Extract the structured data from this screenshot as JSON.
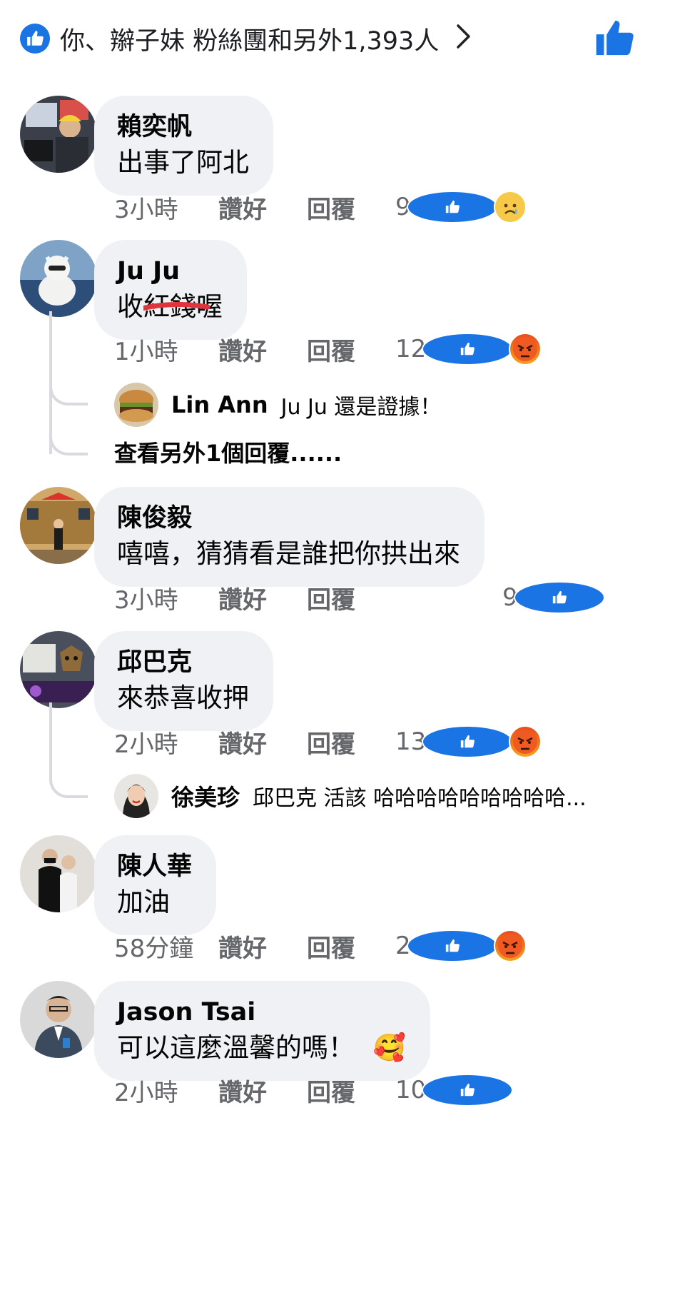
{
  "summary": {
    "text": "你、辮子妹 粉絲團和另外1,393人",
    "chevron": "›",
    "like_icon": "thumbs-up-icon"
  },
  "comments": [
    {
      "name": "賴奕帆",
      "text": "出事了阿北",
      "time": "3小時",
      "like": "讚好",
      "reply": "回覆",
      "count": "9",
      "reactions": [
        "like",
        "sad"
      ]
    },
    {
      "name": "Ju Ju",
      "text_prefix": "收",
      "text_struck": "紅錢",
      "text_suffix": "喔",
      "time": "1小時",
      "like": "讚好",
      "reply": "回覆",
      "count": "12",
      "reactions": [
        "like",
        "angry"
      ],
      "reply_preview": {
        "name": "Lin Ann",
        "text": "Ju Ju 還是證據！"
      },
      "more_replies": "查看另外1個回覆......"
    },
    {
      "name": "陳俊毅",
      "text": "嘻嘻，猜猜看是誰把你拱出來",
      "time": "3小時",
      "like": "讚好",
      "reply": "回覆",
      "count": "9",
      "reactions": [
        "like"
      ]
    },
    {
      "name": "邱巴克",
      "text": "來恭喜收押",
      "time": "2小時",
      "like": "讚好",
      "reply": "回覆",
      "count": "13",
      "reactions": [
        "like",
        "angry"
      ],
      "reply_preview": {
        "name": "徐美珍",
        "text": "邱巴克 活該 哈哈哈哈哈哈哈哈哈..."
      }
    },
    {
      "name": "陳人華",
      "text": "加油",
      "time": "58分鐘",
      "like": "讚好",
      "reply": "回覆",
      "count": "2",
      "reactions": [
        "like",
        "angry"
      ]
    },
    {
      "name": "Jason Tsai",
      "text": "可以這麼溫馨的嗎！",
      "emoji": "🥰",
      "time": "2小時",
      "like": "讚好",
      "reply": "回覆",
      "count": "10",
      "reactions": [
        "like"
      ]
    }
  ],
  "colors": {
    "brand_blue": "#1b74e4",
    "bubble": "#eff1f4",
    "meta_gray": "#65676b",
    "strike_red": "#e0343c"
  }
}
